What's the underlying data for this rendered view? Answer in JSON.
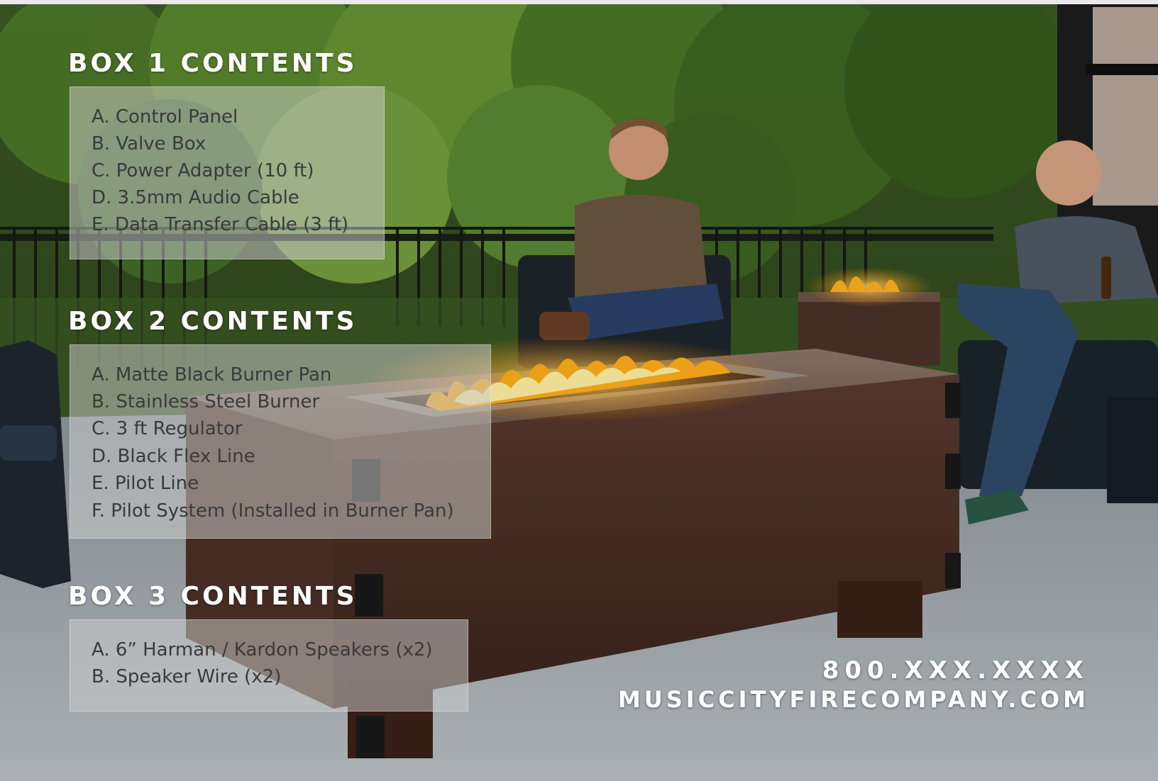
{
  "box1": {
    "title": "BOX 1 CONTENTS",
    "items": [
      "A. Control Panel",
      "B. Valve Box",
      "C. Power Adapter  (10 ft)",
      "D. 3.5mm Audio Cable",
      "E. Data Transfer Cable (3 ft)"
    ]
  },
  "box2": {
    "title": "BOX 2 CONTENTS",
    "items": [
      "A. Matte Black Burner Pan",
      "B. Stainless Steel Burner",
      "C. 3 ft Regulator",
      "D. Black Flex Line",
      "E. Pilot Line",
      "F. Pilot System (Installed in Burner Pan)"
    ]
  },
  "box3": {
    "title": "BOX 3 CONTENTS",
    "items": [
      "A. 6” Harman / Kardon Speakers (x2)",
      "B. Speaker Wire (x2)"
    ]
  },
  "contact": {
    "phone": "800.XXX.XXXX",
    "website": "MUSICCITYFIRECOMPANY.COM"
  },
  "colors": {
    "heading_text": "#ffffff",
    "box_background": "rgba(205,205,205,0.52)",
    "list_text": "#3a3a3a",
    "fire": "#ffb020"
  }
}
